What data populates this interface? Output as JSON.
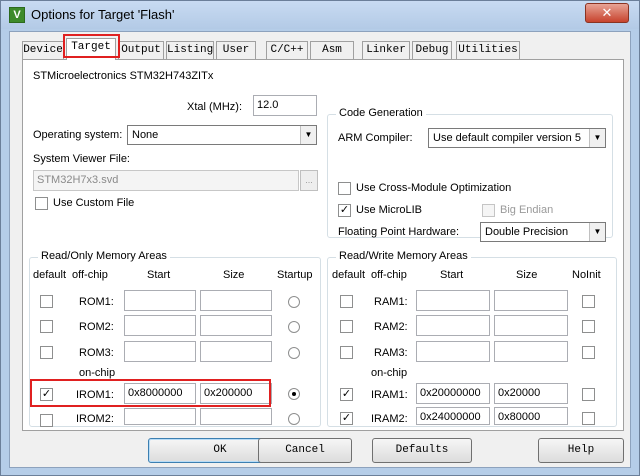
{
  "window": {
    "title": "Options for Target 'Flash'",
    "app_icon": "uvision-icon",
    "close_glyph": "✕",
    "icon_letter": "V"
  },
  "tabs": [
    {
      "label": "Device"
    },
    {
      "label": "Target"
    },
    {
      "label": "Output"
    },
    {
      "label": "Listing"
    },
    {
      "label": "User"
    },
    {
      "label": "C/C++"
    },
    {
      "label": "Asm"
    },
    {
      "label": "Linker"
    },
    {
      "label": "Debug"
    },
    {
      "label": "Utilities"
    }
  ],
  "active_tab": "Target",
  "device_name": "STMicroelectronics STM32H743ZITx",
  "xtal": {
    "label": "Xtal (MHz):",
    "value": "12.0"
  },
  "os": {
    "label": "Operating system:",
    "value": "None"
  },
  "svd": {
    "label": "System Viewer File:",
    "value": "STM32H7x3.svd",
    "browse": "...",
    "custom_label": "Use Custom File",
    "custom_checked": false
  },
  "codegen": {
    "title": "Code Generation",
    "compiler_label": "ARM Compiler:",
    "compiler_value": "Use default compiler version 5",
    "cross_module_label": "Use Cross-Module Optimization",
    "cross_module_checked": false,
    "microlib_label": "Use MicroLIB",
    "microlib_checked": true,
    "big_endian_label": "Big Endian",
    "big_endian_checked": false,
    "fpu_label": "Floating Point Hardware:",
    "fpu_value": "Double Precision"
  },
  "rom": {
    "title": "Read/Only Memory Areas",
    "headers": {
      "default": "default",
      "offchip": "off-chip",
      "start": "Start",
      "size": "Size",
      "startup": "Startup"
    },
    "onchip_label": "on-chip",
    "rows": [
      {
        "name": "ROM1:",
        "default": false,
        "start": "",
        "size": "",
        "startup": false
      },
      {
        "name": "ROM2:",
        "default": false,
        "start": "",
        "size": "",
        "startup": false
      },
      {
        "name": "ROM3:",
        "default": false,
        "start": "",
        "size": "",
        "startup": false
      },
      {
        "name": "IROM1:",
        "default": true,
        "start": "0x8000000",
        "size": "0x200000",
        "startup": true
      },
      {
        "name": "IROM2:",
        "default": false,
        "start": "",
        "size": "",
        "startup": false
      }
    ]
  },
  "ram": {
    "title": "Read/Write Memory Areas",
    "headers": {
      "default": "default",
      "offchip": "off-chip",
      "start": "Start",
      "size": "Size",
      "noinit": "NoInit"
    },
    "onchip_label": "on-chip",
    "rows": [
      {
        "name": "RAM1:",
        "default": false,
        "start": "",
        "size": "",
        "noinit": false
      },
      {
        "name": "RAM2:",
        "default": false,
        "start": "",
        "size": "",
        "noinit": false
      },
      {
        "name": "RAM3:",
        "default": false,
        "start": "",
        "size": "",
        "noinit": false
      },
      {
        "name": "IRAM1:",
        "default": true,
        "start": "0x20000000",
        "size": "0x20000",
        "noinit": false
      },
      {
        "name": "IRAM2:",
        "default": true,
        "start": "0x24000000",
        "size": "0x80000",
        "noinit": false
      }
    ]
  },
  "buttons": {
    "ok": "OK",
    "cancel": "Cancel",
    "defaults": "Defaults",
    "help": "Help"
  },
  "check_glyph": "✓",
  "dropdown_glyph": "▼",
  "highlight_color": "#e02020"
}
